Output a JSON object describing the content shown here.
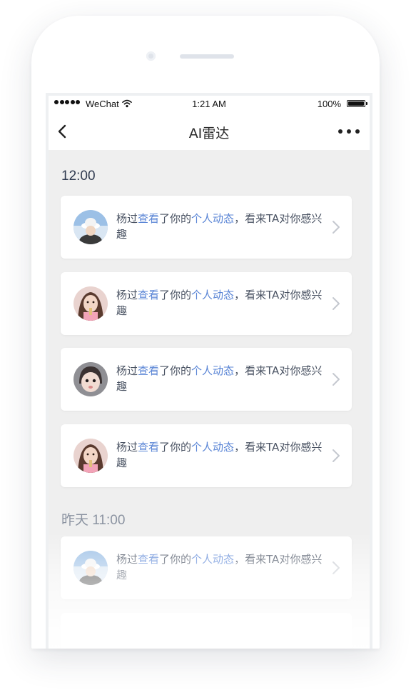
{
  "status_bar": {
    "carrier": "WeChat",
    "time": "1:21 AM",
    "battery": "100%"
  },
  "nav": {
    "title": "AI雷达",
    "back_icon": "chevron-left-icon",
    "more_icon": "more-dots-icon"
  },
  "colors": {
    "link": "#5b86d6",
    "text": "#4a5363",
    "section": "#2f3a4f",
    "background": "#efefef"
  },
  "sections": [
    {
      "time": "12:00",
      "items": [
        {
          "name": "杨过",
          "action": "查看",
          "mid": "了你的",
          "target": "个人动态",
          "tail": "，看来TA对你感兴趣",
          "avatar": "avatar-hat-person"
        },
        {
          "name": "杨过",
          "action": "查看",
          "mid": "了你的",
          "target": "个人动态",
          "tail": "，看来TA对你感兴趣",
          "avatar": "avatar-girl-pink"
        },
        {
          "name": "杨过",
          "action": "查看",
          "mid": "了你的",
          "target": "个人动态",
          "tail": "，看来TA对你感兴趣",
          "avatar": "avatar-child-face"
        },
        {
          "name": "杨过",
          "action": "查看",
          "mid": "了你的",
          "target": "个人动态",
          "tail": "，看来TA对你感兴趣",
          "avatar": "avatar-girl-pink"
        }
      ]
    },
    {
      "time": "昨天 11:00",
      "items": [
        {
          "name": "杨过",
          "action": "查看",
          "mid": "了你的",
          "target": "个人动态",
          "tail": "，看来TA对你感兴趣",
          "avatar": "avatar-hat-person"
        }
      ]
    }
  ]
}
